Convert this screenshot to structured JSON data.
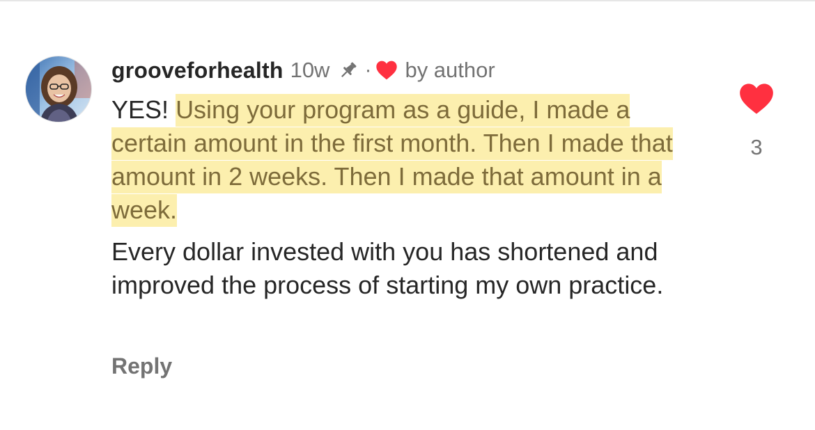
{
  "comment": {
    "username": "grooveforhealth",
    "time": "10w",
    "separator": "·",
    "author_badge": "by author",
    "intro": "YES!",
    "highlighted": "Using your program as a guide, I made a certain amount in the first month. Then I made that amount in 2 weeks. Then I made that amount in a week.",
    "followup": "Every dollar invested with you has shortened and improved the process of starting my own practice.",
    "reply_label": "Reply",
    "like_count": "3",
    "icons": {
      "pin": "pin-icon",
      "author_like": "heart-icon",
      "like": "heart-icon"
    }
  },
  "colors": {
    "heart": "#ff3040",
    "highlight": "#fcefae",
    "highlight_text": "#7d6b3a",
    "secondary_text": "#737373",
    "primary_text": "#262626"
  }
}
